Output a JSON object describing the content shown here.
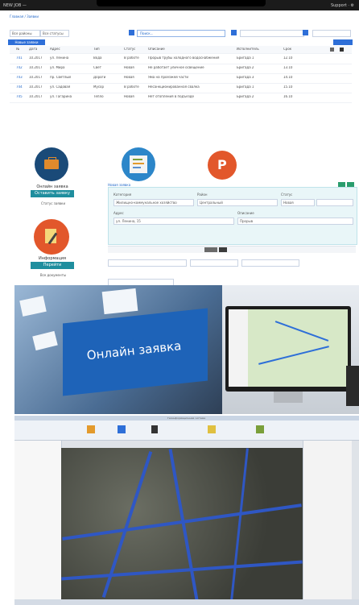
{
  "topbar": {
    "left_text": "NEW JOB  —  ",
    "right_text": "Support  ·  ⚙"
  },
  "portal": {
    "breadcrumb": "Главная / Заявки",
    "filter1": "Все районы",
    "filter2": "Все статусы",
    "search_placeholder": "Поиск...",
    "tag": "Новые заявки",
    "columns": [
      "№",
      "Дата",
      "Адрес",
      "Тип",
      "Статус",
      "Описание",
      "Исполнитель",
      "Срок"
    ],
    "rows": [
      [
        "741",
        "10.2017",
        "ул. Ленина",
        "Вода",
        "В работе",
        "Прорыв трубы холодного водоснабжения",
        "Бригада 1",
        "12.10"
      ],
      [
        "742",
        "10.2017",
        "ул. Мира",
        "Свет",
        "Новая",
        "Не работает уличное освещение",
        "Бригада 2",
        "13.10"
      ],
      [
        "743",
        "10.2017",
        "пр. Светлый",
        "Дороги",
        "Новая",
        "Яма на проезжей части",
        "Бригада 3",
        "14.10"
      ],
      [
        "744",
        "10.2017",
        "ул. Садовая",
        "Мусор",
        "В работе",
        "Несанкционированная свалка",
        "Бригада 1",
        "15.10"
      ],
      [
        "745",
        "10.2017",
        "ул. Гагарина",
        "Тепло",
        "Новая",
        "Нет отопления в подъезде",
        "Бригада 2",
        "16.10"
      ]
    ]
  },
  "cards": {
    "card1_title": "Онлайн заявка",
    "card1_button": "Оставить заявку",
    "card1_sub": "Статус заявки",
    "card2_title": "Информация",
    "card2_button": "Перейти",
    "card2_sub": "Все документы",
    "parking_label": "P"
  },
  "form": {
    "title": "Новая заявка",
    "fields": [
      "Категория",
      "Район",
      "Статус",
      "Адрес",
      "Описание"
    ],
    "values": [
      "Жилищно-коммунальное хозяйство",
      "Центральный",
      "Новая",
      "ул. Ленина, 15",
      "Прорыв"
    ]
  },
  "banner": {
    "online_label": "Онлайн заявка"
  },
  "gis": {
    "window_title": "Геоинформационная система"
  },
  "colors": {
    "accent": "#1f66c9",
    "teal": "#1f8e9e",
    "orange": "#e2572b",
    "navy": "#1a4a78"
  }
}
